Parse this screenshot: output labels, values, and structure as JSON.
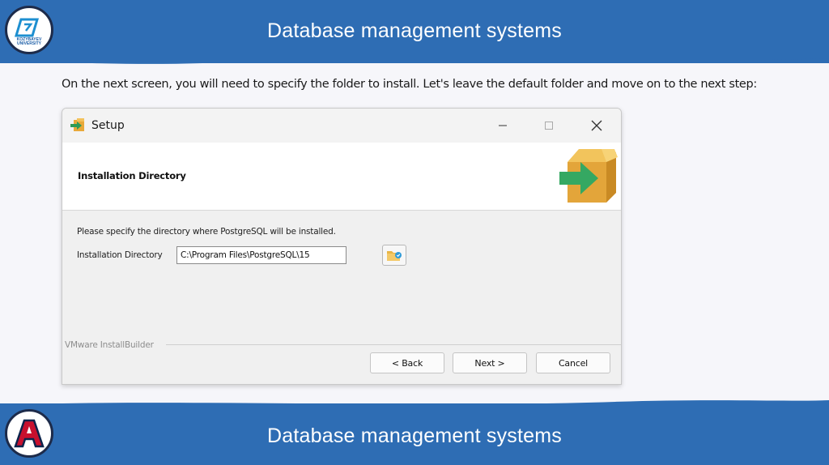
{
  "slide": {
    "header_title": "Database management systems",
    "footer_title": "Database management systems",
    "logo_top_text": "KOZYBAYEV UNIVERSITY",
    "logo_bottom_letter": "A",
    "banner_color": "#2e6db4",
    "instruction": "On the next screen, you will need to specify the folder to install. Let's leave the default folder and move on to the next step:"
  },
  "dialog": {
    "title": "Setup",
    "window_controls": [
      "minimize-icon",
      "maximize-icon",
      "close-icon"
    ],
    "header_title": "Installation Directory",
    "description": "Please specify the directory where PostgreSQL will be installed.",
    "dir_label": "Installation Directory",
    "dir_value": "C:\\Program Files\\PostgreSQL\\15",
    "browse_icon": "folder-browse-icon",
    "footer_brand": "VMware InstallBuilder",
    "buttons": {
      "back": "< Back",
      "next": "Next >",
      "cancel": "Cancel"
    }
  }
}
